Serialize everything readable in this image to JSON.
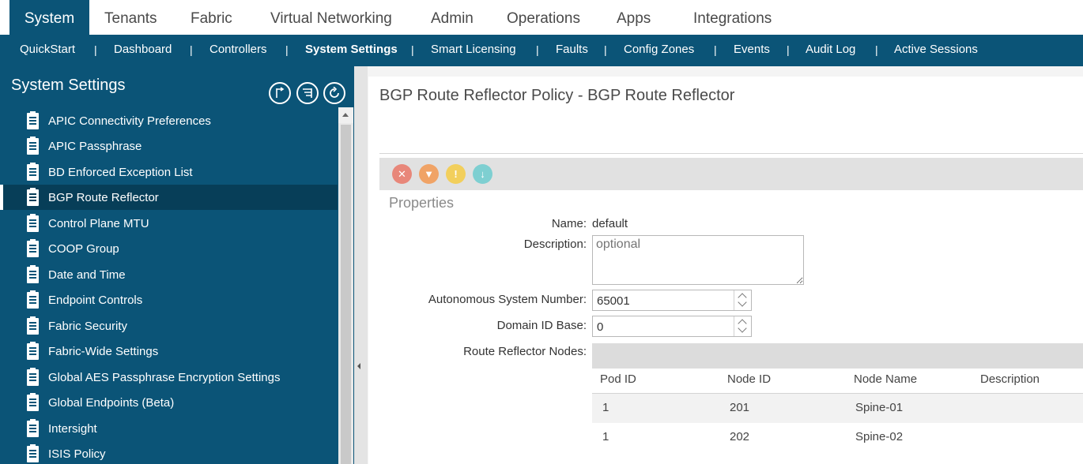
{
  "top_tabs": [
    {
      "label": "System",
      "active": true
    },
    {
      "label": "Tenants"
    },
    {
      "label": "Fabric"
    },
    {
      "label": "Virtual Networking"
    },
    {
      "label": "Admin"
    },
    {
      "label": "Operations"
    },
    {
      "label": "Apps"
    },
    {
      "label": "Integrations"
    }
  ],
  "sub_nav": [
    {
      "label": "QuickStart"
    },
    {
      "label": "Dashboard"
    },
    {
      "label": "Controllers"
    },
    {
      "label": "System Settings",
      "active": true
    },
    {
      "label": "Smart Licensing"
    },
    {
      "label": "Faults"
    },
    {
      "label": "Config Zones"
    },
    {
      "label": "Events"
    },
    {
      "label": "Audit Log"
    },
    {
      "label": "Active Sessions"
    }
  ],
  "separator": "|",
  "sidebar": {
    "title": "System Settings",
    "items": [
      {
        "label": "APIC Connectivity Preferences"
      },
      {
        "label": "APIC Passphrase"
      },
      {
        "label": "BD Enforced Exception List"
      },
      {
        "label": "BGP Route Reflector",
        "selected": true
      },
      {
        "label": "Control Plane MTU"
      },
      {
        "label": "COOP Group"
      },
      {
        "label": "Date and Time"
      },
      {
        "label": "Endpoint Controls"
      },
      {
        "label": "Fabric Security"
      },
      {
        "label": "Fabric-Wide Settings"
      },
      {
        "label": "Global AES Passphrase Encryption Settings"
      },
      {
        "label": "Global Endpoints (Beta)"
      },
      {
        "label": "Intersight"
      },
      {
        "label": "ISIS Policy"
      }
    ]
  },
  "main": {
    "title": "BGP Route Reflector Policy - BGP Route Reflector",
    "properties_heading": "Properties",
    "fields": {
      "name_label": "Name:",
      "name_value": "default",
      "description_label": "Description:",
      "description_placeholder": "optional",
      "asn_label": "Autonomous System Number:",
      "asn_value": "65001",
      "domain_label": "Domain ID Base:",
      "domain_value": "0",
      "rr_nodes_label": "Route Reflector Nodes:"
    },
    "table": {
      "columns": [
        "Pod ID",
        "Node ID",
        "Node Name",
        "Description"
      ],
      "rows": [
        {
          "pod_id": "1",
          "node_id": "201",
          "node_name": "Spine-01",
          "description": ""
        },
        {
          "pod_id": "1",
          "node_id": "202",
          "node_name": "Spine-02",
          "description": ""
        }
      ]
    }
  },
  "colors": {
    "brand": "#0b5477",
    "critical": "#e8877a",
    "major": "#f0a366",
    "minor": "#f2cf5c",
    "warning": "#7ecfd1"
  }
}
